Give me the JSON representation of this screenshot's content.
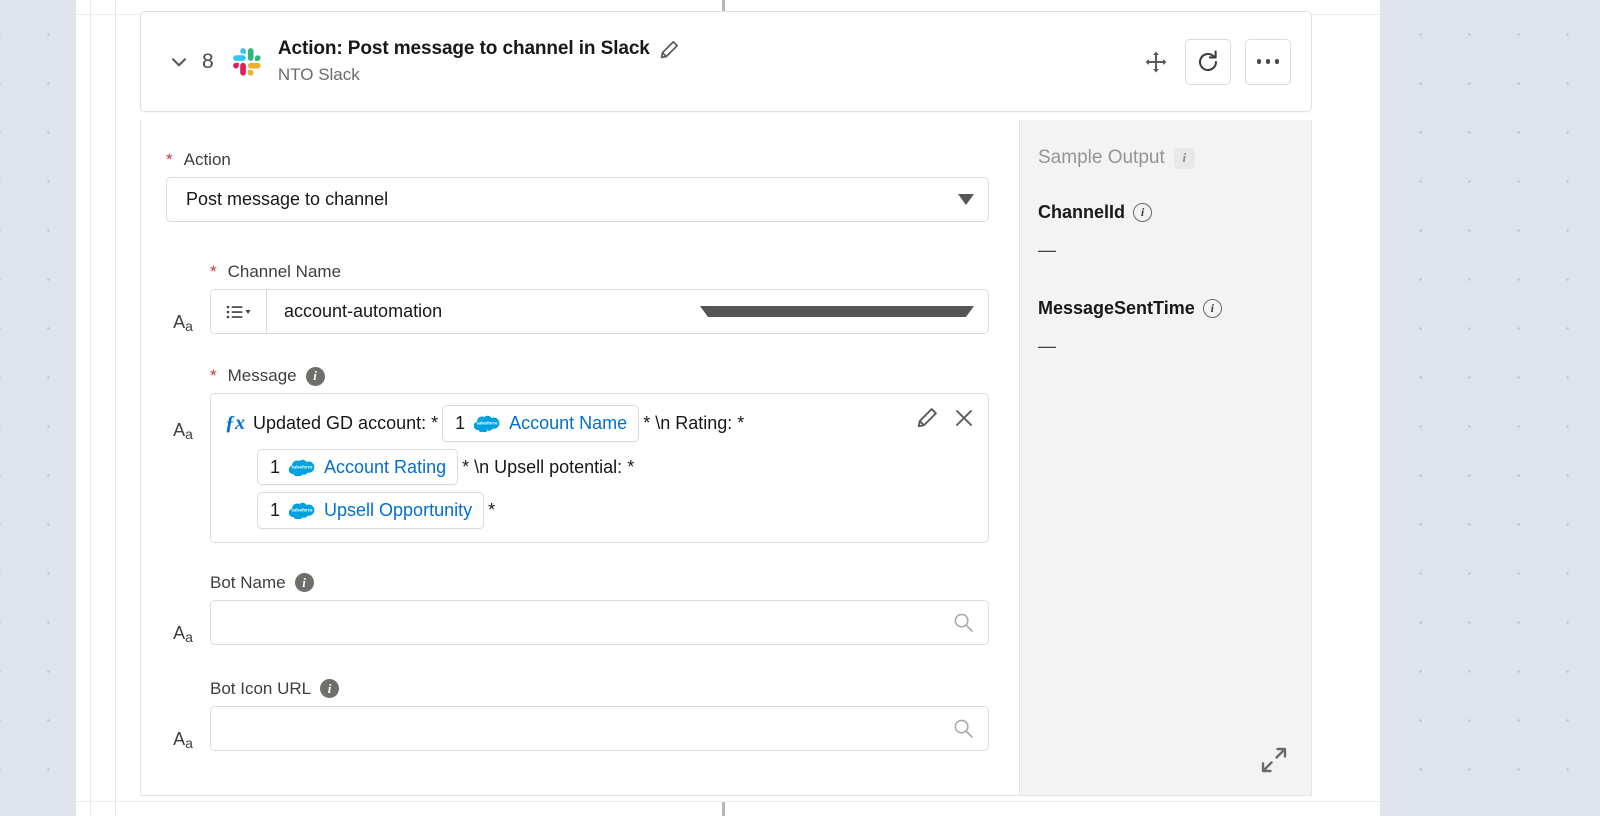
{
  "step": {
    "number": "8",
    "title": "Action: Post message to channel in Slack",
    "subtitle": "NTO Slack",
    "app_icon": "slack-logo",
    "collapse_icon": "chevron-down-icon",
    "edit_icon": "pencil-icon",
    "move_icon": "move-handle-icon",
    "refresh_icon": "refresh-icon",
    "more_icon": "more-options-icon"
  },
  "form": {
    "action": {
      "label": "Action",
      "required": true,
      "value": "Post message to channel",
      "dropdown_icon": "chevron-down-icon"
    },
    "channel_name": {
      "label": "Channel Name",
      "required": true,
      "value": "account-automation",
      "type_indicator": "Aa",
      "picklist_icon": "list-picklist-icon",
      "dropdown_icon": "chevron-down-icon"
    },
    "message": {
      "label": "Message",
      "required": true,
      "info_icon": "info-icon",
      "type_indicator": "Aa",
      "formula_icon": "fx-icon",
      "edit_icon": "pencil-icon",
      "clear_icon": "close-icon",
      "segments": [
        {
          "kind": "text",
          "text": "Updated GD account: *"
        },
        {
          "kind": "chip",
          "index": "1",
          "source": "salesforce",
          "name": "Account Name"
        },
        {
          "kind": "text",
          "text": "* \\n Rating: *"
        },
        {
          "kind": "break"
        },
        {
          "kind": "chip",
          "index": "1",
          "source": "salesforce",
          "name": "Account Rating"
        },
        {
          "kind": "text",
          "text": "* \\n Upsell potential: *"
        },
        {
          "kind": "break"
        },
        {
          "kind": "chip",
          "index": "1",
          "source": "salesforce",
          "name": "Upsell Opportunity"
        },
        {
          "kind": "text",
          "text": "*"
        }
      ]
    },
    "bot_name": {
      "label": "Bot Name",
      "required": false,
      "value": "",
      "placeholder": "",
      "info_icon": "info-icon",
      "type_indicator": "Aa",
      "search_icon": "search-icon"
    },
    "bot_icon_url": {
      "label": "Bot Icon URL",
      "required": false,
      "value": "",
      "placeholder": "",
      "info_icon": "info-icon",
      "type_indicator": "Aa",
      "search_icon": "search-icon"
    }
  },
  "sample_output": {
    "title": "Sample Output",
    "info_icon": "info-icon",
    "items": [
      {
        "key": "ChannelId",
        "value": "—",
        "info_icon": "info-icon"
      },
      {
        "key": "MessageSentTime",
        "value": "—",
        "info_icon": "info-icon"
      }
    ],
    "expand_icon": "expand-diagonal-icon"
  },
  "colors": {
    "canvas": "#ffffff",
    "page_background": "#dfe4ec",
    "link": "#0070d2",
    "required_asterisk": "#c23934",
    "output_panel": "#f3f3f3",
    "border": "#dddbda"
  }
}
